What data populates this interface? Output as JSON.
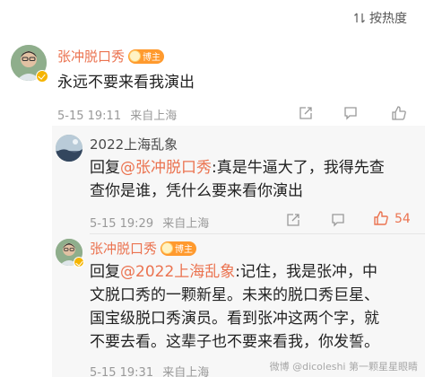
{
  "sort": {
    "label": "按热度"
  },
  "comment_main": {
    "username": "张冲脱口秀",
    "badge": "博主",
    "text": "永远不要来看我演出",
    "time": "5-15 19:11",
    "location": "来自上海"
  },
  "reply_1": {
    "username": "2022上海乱象",
    "prefix": "回复",
    "mention": "@张冲脱口秀",
    "text_line1": ":真是牛逼大了，我得先查",
    "text_line2": "查你是谁，凭什么要来看你演出",
    "time": "5-15 19:29",
    "location": "来自上海",
    "like_count": "54"
  },
  "reply_2": {
    "username": "张冲脱口秀",
    "badge": "博主",
    "prefix": "回复",
    "mention": "@2022上海乱象",
    "text_line1": ":记住，我是张冲，中",
    "text_line2": "文脱口秀的一颗新星。未来的脱口秀巨星、",
    "text_line3": "国宝级脱口秀演员。看到张冲这两个字，就",
    "text_line4": "不要去看。这辈子也不要来看我，你发誓。",
    "time": "5-15 19:31",
    "location": "来自上海"
  },
  "watermark": "微博 @dicoleshi 第一颗星星眼睛",
  "colors": {
    "accent": "#eb7350",
    "tag": "#ff9a2e",
    "meta": "#999999"
  }
}
